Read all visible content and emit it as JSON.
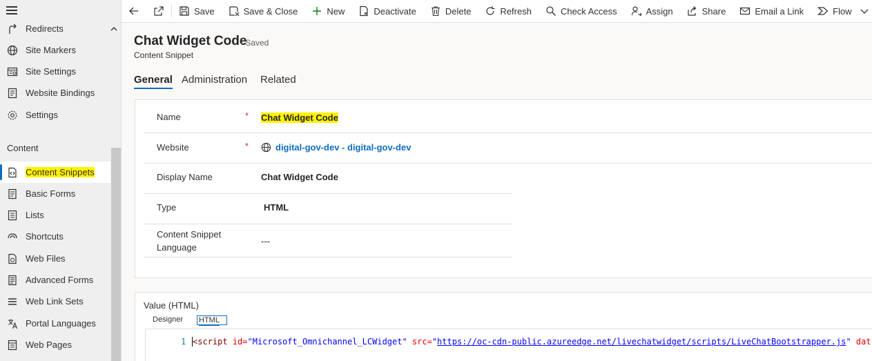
{
  "sidebar": {
    "items_top": [
      {
        "label": "Redirects",
        "icon": "redirect-icon"
      },
      {
        "label": "Site Markers",
        "icon": "globe-icon"
      },
      {
        "label": "Site Settings",
        "icon": "site-settings-icon"
      },
      {
        "label": "Website Bindings",
        "icon": "binding-icon"
      },
      {
        "label": "Settings",
        "icon": "gear-icon"
      }
    ],
    "section_label": "Content",
    "items_content": [
      {
        "label": "Content Snippets",
        "icon": "snippet-icon"
      },
      {
        "label": "Basic Forms",
        "icon": "form-icon"
      },
      {
        "label": "Lists",
        "icon": "list-icon"
      },
      {
        "label": "Shortcuts",
        "icon": "shortcut-icon"
      },
      {
        "label": "Web Files",
        "icon": "file-icon"
      },
      {
        "label": "Advanced Forms",
        "icon": "advanced-form-icon"
      },
      {
        "label": "Web Link Sets",
        "icon": "link-set-icon"
      },
      {
        "label": "Portal Languages",
        "icon": "language-icon"
      },
      {
        "label": "Web Pages",
        "icon": "web-page-icon"
      }
    ]
  },
  "commandbar": {
    "save": "Save",
    "save_close": "Save & Close",
    "new": "New",
    "deactivate": "Deactivate",
    "delete": "Delete",
    "refresh": "Refresh",
    "check_access": "Check Access",
    "assign": "Assign",
    "share": "Share",
    "email_link": "Email a Link",
    "flow": "Flow"
  },
  "header": {
    "title": "Chat Widget Code",
    "status": "- Saved",
    "entity": "Content Snippet"
  },
  "tabs": [
    "General",
    "Administration",
    "Related"
  ],
  "form": {
    "name_label": "Name",
    "name_value": "Chat Widget Code",
    "website_label": "Website",
    "website_value": "digital-gov-dev - digital-gov-dev",
    "display_name_label": "Display Name",
    "display_name_value": "Chat Widget Code",
    "type_label": "Type",
    "type_value": "HTML",
    "language_label_1": "Content Snippet",
    "language_label_2": "Language",
    "language_value": "---",
    "required_marker": "*"
  },
  "value_section": {
    "title": "Value (HTML)",
    "tab_designer": "Designer",
    "tab_html": "HTML",
    "line_number": "1",
    "code": {
      "open": "<",
      "tag": "script",
      "attr1": " id=",
      "val1": "\"Microsoft_Omnichannel_LCWidget\"",
      "attr2": " src=",
      "quote_open": "\"",
      "url": "https://oc-cdn-public.azureedge.net/livechatwidget/scripts/LiveChatBootstrapper.js",
      "quote_close": "\"",
      "attr3": " dat"
    }
  },
  "colors": {
    "accent": "#0f6cbd",
    "highlight": "#fff200",
    "required": "#c4314b"
  }
}
